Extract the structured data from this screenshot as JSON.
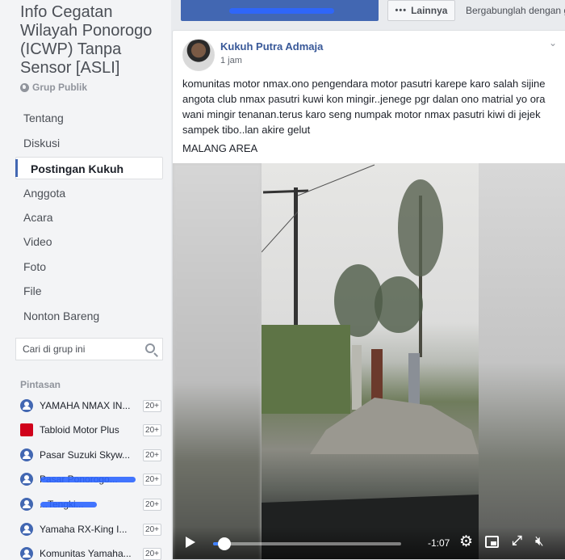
{
  "group": {
    "title": "Info Cegatan Wilayah Ponorogo (ICWP) Tanpa Sensor [ASLI]",
    "type": "Grup Publik"
  },
  "nav": [
    {
      "label": "Tentang"
    },
    {
      "label": "Diskusi"
    },
    {
      "label": "Postingan Kukuh",
      "active": true
    },
    {
      "label": "Anggota"
    },
    {
      "label": "Acara"
    },
    {
      "label": "Video"
    },
    {
      "label": "Foto"
    },
    {
      "label": "File"
    },
    {
      "label": "Nonton Bareng"
    }
  ],
  "search": {
    "placeholder": "Cari di grup ini"
  },
  "shortcuts": {
    "title": "Pintasan",
    "items": [
      {
        "label": "YAMAHA NMAX IN...",
        "badge": "20+",
        "icon": "group-icon"
      },
      {
        "label": "Tabloid Motor Plus",
        "badge": "20+",
        "icon": "tabloid-logo-icon"
      },
      {
        "label": "Pasar Suzuki Skyw...",
        "badge": "20+",
        "icon": "group-icon"
      },
      {
        "label": "Pasar Ponorogo...",
        "badge": "20+",
        "icon": "group-icon"
      },
      {
        "label": "...Tengki...",
        "badge": "20+",
        "icon": "group-icon"
      },
      {
        "label": "Yamaha RX-King I...",
        "badge": "20+",
        "icon": "group-icon"
      },
      {
        "label": "Komunitas Yamaha...",
        "badge": "20+",
        "icon": "group-icon"
      }
    ]
  },
  "topbar": {
    "more_label": "Lainnya",
    "join_text": "Bergabunglah dengan gr"
  },
  "post": {
    "author": "Kukuh Putra Admaja",
    "time": "1 jam",
    "text": "komunitas motor nmax.ono pengendara motor pasutri karepe karo salah sijine angota club nmax pasutri kuwi kon mingir..jenege pgr dalan ono matrial yo ora wani mingir tenanan.terus karo seng numpak motor nmax pasutri kiwi di jejek sampek tibo..lan akire gelut",
    "area": "MALANG AREA"
  },
  "video": {
    "time_remaining": "-1:07",
    "progress": 0.06
  },
  "colors": {
    "accent": "#4267b2",
    "link": "#385898",
    "sidebar_bg": "#f3f4f6",
    "page_bg": "#e9ebee",
    "progress": "#4080ff"
  }
}
